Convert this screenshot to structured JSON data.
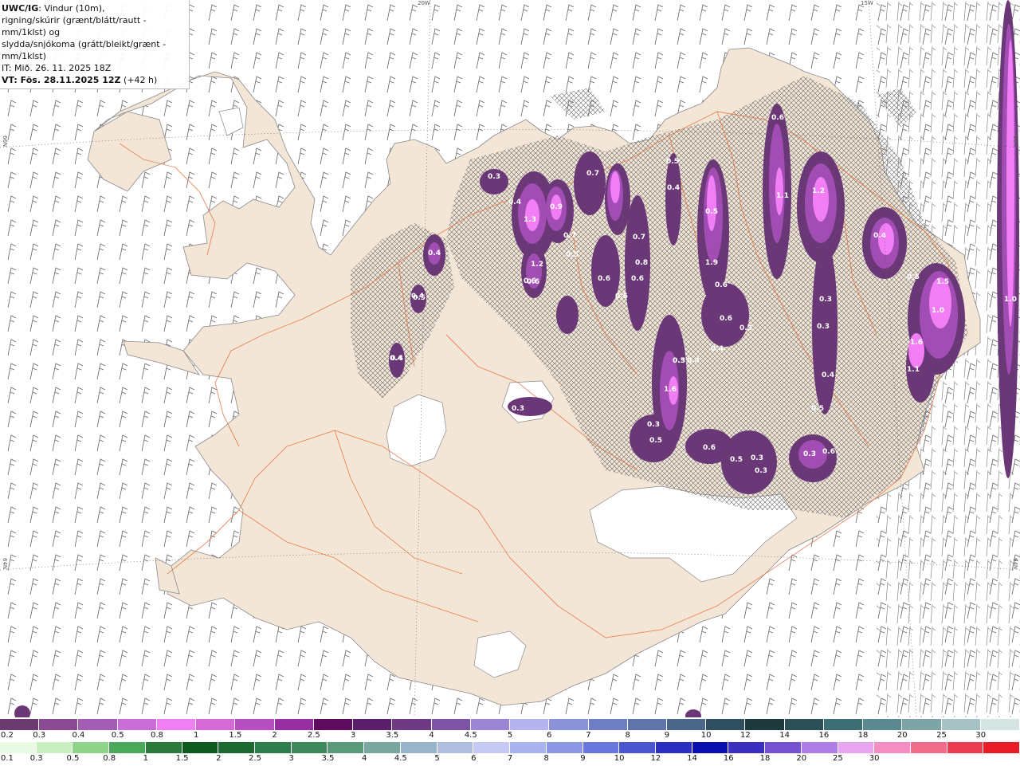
{
  "header": {
    "model": "UWC/IG",
    "line1_rest": ": Vindur (10m),",
    "line2": "rigning/skúrir (grænt/blátt/rautt - mm/1klst) og",
    "line3": "slydda/snjókoma (grátt/bleikt/grænt - mm/1klst)",
    "it": "IT: Mið. 26. 11. 2025 18Z",
    "vt_label": "VT: Fös. 28.11.2025 12Z",
    "lead": " (+42 h)"
  },
  "grid_labels": {
    "top_20w": "20W",
    "top_15w": "15W",
    "left_66n": "66N",
    "left_64n": "64N",
    "right_66n": "66N",
    "right_64n": "64N"
  },
  "colors": {
    "land": "#f3e6d7",
    "sea": "#ffffff",
    "roads": "#e8733e",
    "precip_light": "#6b3877",
    "precip_mid": "#a14db4",
    "precip_heavy": "#f27ef5"
  },
  "precip_values": [
    "0.3",
    "0.4",
    "0.5",
    "0.4",
    "0.4",
    "1.3",
    "0.9",
    "0.7",
    "0.5",
    "0.7",
    "0.6",
    "1.2",
    "0.5",
    "0.7",
    "0.8",
    "0.6",
    "0.6",
    "0.5",
    "0.4",
    "0.5",
    "1.9",
    "0.6",
    "0.6",
    "0.4",
    "0.3",
    "0.4",
    "0.3",
    "0.5",
    "0.3",
    "1.6",
    "0.5",
    "0.6",
    "0.5",
    "0.3",
    "0.3",
    "0.3",
    "0.6",
    "0.6",
    "1.1",
    "1.2",
    "0.4",
    "0.5",
    "0.3",
    "0.3",
    "0.4",
    "0.5",
    "1.5",
    "1.0",
    "1.6",
    "1.1",
    "0.3",
    "0.6",
    "0.4",
    "0.4",
    "1.0"
  ],
  "legend_snow": {
    "colors": [
      "#6b3a6e",
      "#8a4a92",
      "#a35db3",
      "#c86ed6",
      "#f07ff4",
      "#d56ad6",
      "#b650c0",
      "#972fa3",
      "#5e0d5e",
      "#5a1f6b",
      "#6f3a84",
      "#7d54a4",
      "#9a86d2",
      "#b6b4ee",
      "#8a93d8",
      "#6f7ec2",
      "#5f74a9",
      "#4a6689",
      "#2f4f5f",
      "#1f3a3c",
      "#2c4e55",
      "#3d6e74",
      "#5a8a90",
      "#7fa4a6",
      "#a6c2c2",
      "#d5e3e2"
    ],
    "labels": [
      "0.2",
      "0.3",
      "0.4",
      "0.5",
      "0.8",
      "1",
      "1.5",
      "2",
      "2.5",
      "3",
      "3.5",
      "4",
      "4.5",
      "5",
      "6",
      "7",
      "8",
      "9",
      "10",
      "12",
      "14",
      "16",
      "18",
      "20",
      "25",
      "30"
    ]
  },
  "legend_rain": {
    "colors": [
      "#eafbe5",
      "#c7efc0",
      "#8fd48a",
      "#4aa85a",
      "#2b7a3c",
      "#0e5a1e",
      "#1c6a30",
      "#2e7d4a",
      "#3f8a5c",
      "#5a9a78",
      "#7aa6a0",
      "#98b4c8",
      "#b2bde2",
      "#c5c9f4",
      "#a9b3f0",
      "#8c98e6",
      "#6a77dc",
      "#4b55cf",
      "#2a2fc2",
      "#0c0fb0",
      "#3b2fc0",
      "#7452d2",
      "#ad7fe6",
      "#e8a6ef",
      "#f58fc1",
      "#f06a8a",
      "#ea3c4f",
      "#e81c25"
    ],
    "labels": [
      "0.1",
      "0.3",
      "0.5",
      "0.8",
      "1",
      "1.5",
      "2",
      "2.5",
      "3",
      "3.5",
      "4",
      "4.5",
      "5",
      "6",
      "7",
      "8",
      "9",
      "10",
      "12",
      "14",
      "16",
      "18",
      "20",
      "25",
      "30"
    ]
  }
}
